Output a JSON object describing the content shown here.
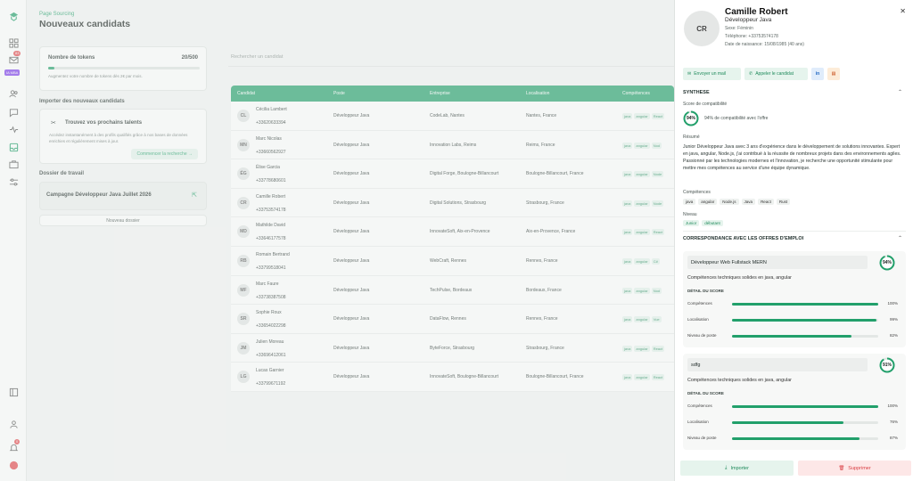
{
  "sidebar": {
    "items": [
      "logo-icon",
      "grid-icon",
      "mail-icon",
      "users-icon",
      "chat-icon",
      "pulse-icon",
      "inbox-icon",
      "briefcase-icon",
      "sliders-icon"
    ],
    "mail_badge": "83",
    "tag": "IA MBA",
    "bottom_badge": "0"
  },
  "header": {
    "breadcrumb": "Page Sourcing",
    "title": "Nouveaux candidats"
  },
  "tokens": {
    "label": "Nombre de tokens",
    "count": "20/500",
    "progress": 0.04,
    "hint": "Augmentez votre nombre de tokens dès 2€ par mois."
  },
  "import": {
    "section": "Importer des nouveaux candidats",
    "title": "Trouvez vos prochains talents",
    "text": "Accédez instantanément à des profils qualifiés grâce à nos bases de données enrichies et régulièrement mises à jour.",
    "button": "Commencer la recherche"
  },
  "folders": {
    "section": "Dossier de travail",
    "name": "Campagne Développeur Java Juillet 2026",
    "new": "Nouveau dossier"
  },
  "search": {
    "placeholder": "Rechercher un candidat"
  },
  "table": {
    "headers": [
      "Candidat",
      "Poste",
      "Entreprise",
      "Localisation",
      "Compétences"
    ],
    "rows": [
      {
        "initials": "CL",
        "name": "Cécilia Lambert",
        "phone": "+33620633394",
        "poste": "Développeur Java",
        "entreprise": "CodeLab, Nantes",
        "loc": "Nantes, France",
        "skills": [
          "java",
          "angular",
          "React"
        ]
      },
      {
        "initials": "MN",
        "name": "Marc Nicolas",
        "phone": "+33660562927",
        "poste": "Développeur Java",
        "entreprise": "Innovation Labs, Reims",
        "loc": "Reims, France",
        "skills": [
          "java",
          "angular",
          "Nod"
        ]
      },
      {
        "initials": "ÉG",
        "name": "Élise Garcia",
        "phone": "+33778680601",
        "poste": "Développeur Java",
        "entreprise": "Digital Forge, Boulogne-Billancourt",
        "loc": "Boulogne-Billancourt, France",
        "skills": [
          "java",
          "angular",
          "Node"
        ]
      },
      {
        "initials": "CR",
        "name": "Camille Robert",
        "phone": "+33753574178",
        "poste": "Développeur Java",
        "entreprise": "Digital Solutions, Strasbourg",
        "loc": "Strasbourg, France",
        "skills": [
          "java",
          "angular",
          "Node"
        ]
      },
      {
        "initials": "MD",
        "name": "Mathilde David",
        "phone": "+33646177578",
        "poste": "Développeur Java",
        "entreprise": "InnovateSoft, Aix-en-Provence",
        "loc": "Aix-en-Provence, France",
        "skills": [
          "java",
          "angular",
          "React"
        ]
      },
      {
        "initials": "RB",
        "name": "Romain Bertrand",
        "phone": "+33799518041",
        "poste": "Développeur Java",
        "entreprise": "WebCraft, Rennes",
        "loc": "Rennes, France",
        "skills": [
          "java",
          "angular",
          "C#"
        ]
      },
      {
        "initials": "MF",
        "name": "Marc Faure",
        "phone": "+33738387508",
        "poste": "Développeur Java",
        "entreprise": "TechPulse, Bordeaux",
        "loc": "Bordeaux, France",
        "skills": [
          "java",
          "angular",
          "Nod"
        ]
      },
      {
        "initials": "SR",
        "name": "Sophie Roux",
        "phone": "+33654022298",
        "poste": "Développeur Java",
        "entreprise": "DataFlow, Rennes",
        "loc": "Rennes, France",
        "skills": [
          "java",
          "angular",
          "Vue"
        ]
      },
      {
        "initials": "JM",
        "name": "Julien Moreau",
        "phone": "+33696412061",
        "poste": "Développeur Java",
        "entreprise": "ByteForce, Strasbourg",
        "loc": "Strasbourg, France",
        "skills": [
          "java",
          "angular",
          "React"
        ]
      },
      {
        "initials": "LG",
        "name": "Lucas Garnier",
        "phone": "+33799671192",
        "poste": "Développeur Java",
        "entreprise": "InnovateSoft, Boulogne-Billancourt",
        "loc": "Boulogne-Billancourt, France",
        "skills": [
          "java",
          "angular",
          "React"
        ]
      }
    ]
  },
  "drawer": {
    "initials": "CR",
    "name": "Camille Robert",
    "role": "Développeur Java",
    "sexe": "Sexe: Féminin",
    "phone": "Téléphone: +33753574178",
    "birth": "Date de naissance: 15/08/1985 (40 ans)",
    "actions": {
      "mail": "Envoyer un mail",
      "call": "Appeler le candidat",
      "linkedin": "in"
    },
    "synthese": "SYNTHESE",
    "score_label": "Score de compatibilité",
    "score": 94,
    "score_text": "94% de compatibilité avec l'offre",
    "resume_label": "Résumé",
    "resume": "Junior Développeur Java avec 3 ans d'expérience dans le développement de solutions innovantes. Expert en java, angular, Node.js, j'ai contribué à la réussite de nombreux projets dans des environnements agiles. Passionné par les technologies modernes et l'innovation, je recherche une opportunité stimulante pour mettre mes compétences au service d'une équipe dynamique.",
    "skills_label": "Compétences",
    "skills": [
      "java",
      "angular",
      "Node.js",
      "Java",
      "React",
      "Rust"
    ],
    "level_label": "Niveau",
    "levels": [
      "Junior",
      "débutant"
    ],
    "offers_title": "CORRESPONDANCE AVEC LES OFFRES D'EMPLOI",
    "detail_label": "DÉTAIL DU SCORE",
    "offers": [
      {
        "title": "Développeur Web Fullstack MERN",
        "score": 94,
        "desc": "Compétences techniques solides en java, angular",
        "rows": [
          {
            "k": "Compétences",
            "v": 100
          },
          {
            "k": "Localisation",
            "v": 99
          },
          {
            "k": "Niveau de poste",
            "v": 82
          }
        ]
      },
      {
        "title": "sdfg",
        "score": 91,
        "desc": "Compétences techniques solides en java, angular",
        "rows": [
          {
            "k": "Compétences",
            "v": 100
          },
          {
            "k": "Localisation",
            "v": 76
          },
          {
            "k": "Niveau de poste",
            "v": 87
          }
        ]
      }
    ],
    "footer": {
      "import": "Importer",
      "delete": "Supprimer"
    }
  },
  "colors": {
    "accent": "#22a06b",
    "danger": "#e5484d",
    "brand_tag": "#7c3aed"
  }
}
